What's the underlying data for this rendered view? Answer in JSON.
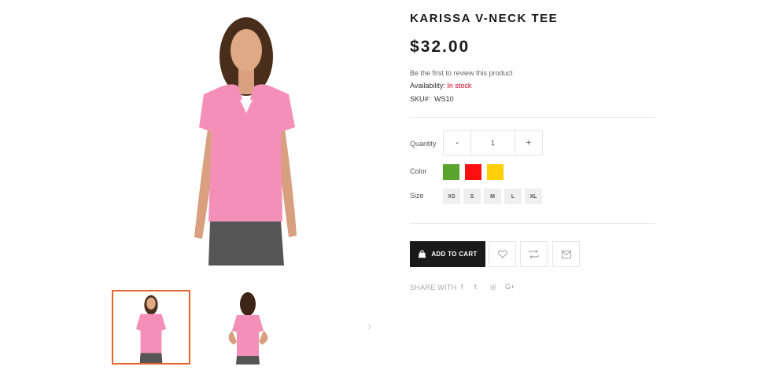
{
  "product": {
    "title": "KARISSA V-NECK TEE",
    "price": "$32.00",
    "review_link": "Be the first to review this product",
    "availability_label": "Availability:",
    "availability_value": "In stock",
    "sku_label": "SKU#:",
    "sku_value": "WS10"
  },
  "quantity": {
    "label": "Quantity",
    "minus": "-",
    "value": "1",
    "plus": "+"
  },
  "color": {
    "label": "Color",
    "swatches": [
      "#58a42c",
      "#ff1010",
      "#ffcf0a"
    ]
  },
  "size": {
    "label": "Size",
    "options": [
      "XS",
      "S",
      "M",
      "L",
      "XL"
    ]
  },
  "actions": {
    "add_to_cart": "ADD TO CART"
  },
  "share": {
    "label": "SHARE WITH",
    "networks": [
      "f",
      "t",
      "◎",
      "G+"
    ]
  },
  "gallery": {
    "prev_arrow": "‹",
    "next_arrow": "›"
  },
  "colors": {
    "accent_orange": "#e8622a",
    "stock_red": "#d0021b",
    "shirt_pink": "#f48fb8"
  }
}
